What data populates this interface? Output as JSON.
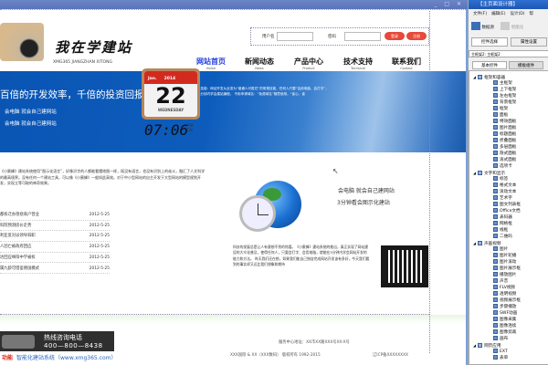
{
  "window": {
    "controls": "_ □ ✕"
  },
  "header": {
    "logo_title": "我在学建站",
    "logo_sub": "XMG365 JIANGZHAN XITONG",
    "login": {
      "user_label": "用户名",
      "pass_label": "密码",
      "login_btn": "登录",
      "register_btn": "注册"
    },
    "nav": [
      {
        "label": "网站首页",
        "en": "Home"
      },
      {
        "label": "新闻动态",
        "en": "News"
      },
      {
        "label": "产品中心",
        "en": "Product"
      },
      {
        "label": "技术支持",
        "en": "Technical"
      },
      {
        "label": "联系我们",
        "en": "Contact"
      }
    ]
  },
  "banner": {
    "headline": "百倍的开发效率，千倍的投资回报",
    "line1": "会电脑 就会自己建网站",
    "line2": "会电脑 就会自己建网站",
    "para": "不用专业技能：网站开发从此变为“普通人可胜任”的常规技能，任何人只要“会用电脑、会打字”，就能在几分钟内学会建站编程。 不用申请域名：“免费域名”随意使用，“省心、省"
  },
  "content": {
    "intro": "《小蜜蜂》建站系统使用“图示化语言”，好像识字的人都能看懂地图一样，既没有语言，也没有识别上的歧义，融汇了人文科学的最高境界。没有任何一个建站工具，可以像《小蜜蜂》一般如此高效。对于中小型网站的自主开发于大型网站的模型规划开发，实现立等可取的神奇效果。",
    "news": [
      {
        "title": "都拆迁办阻挠商户营业",
        "date": "2012-5-25"
      },
      {
        "title": "科院预测房价走势",
        "date": "2012-5-25"
      },
      {
        "title": "利亚反对派领导辞职",
        "date": "2012-5-25"
      },
      {
        "title": "人因亡被政府回应",
        "date": "2012-5-25"
      },
      {
        "title": "达回应绵阳中学被拆",
        "date": "2012-5-25"
      },
      {
        "title": "属九龄可借鉴德国模式",
        "date": "2012-5-25"
      }
    ],
    "calendar": {
      "month": "Jan.",
      "year": "2014",
      "day": "22",
      "weekday": "WEDNESDAY",
      "time": "07:06",
      "ampm": "PM",
      "seconds": "58"
    },
    "right_line1": "会电脑 就会自己建网站",
    "right_line2": "3分钟看会图示化建站",
    "para2": "科技的发展总是让人有意想不到的惊喜。《小蜜蜂》建站系统的推出，真正实现了网站建设的大众化普及，使得任何人，只要会打字、会用电脑，就能在3分钟内学会网站开发的能力和方法。 昨天我们还在想，如果我们能自己独自完成网站开发该有多好，今天我们看到的事实却又远比我们想象和期待"
  },
  "footer": {
    "hotline_title": "热线咨询电话",
    "hotline_number": "400—800—8438",
    "brand_logo": "功能",
    "brand": "智能化建站系统（www.xmg365.com）",
    "address": "服务中心地址：XX市XX路XXX号XX-X号",
    "copyright": "XXX国际 & XX（XXX数码）  版权所有  1992-2015",
    "icp": "辽ICP备XXXXXXXX"
  },
  "panel": {
    "title": "【主页面设计器】",
    "menu": [
      "文件(F)",
      "编辑(E)",
      "设计(D)",
      "帮"
    ],
    "tool1": "数据源",
    "tool2": "智能化",
    "btn_select": "控件选择",
    "btn_props": "属性设置",
    "path": "主框架2: 主框架2",
    "tab_basic": "基本控件",
    "tab_template": "模板组件",
    "tree": [
      {
        "group": "框架和容器",
        "items": [
          "主框架",
          "上下框架",
          "左右框架",
          "背景框架",
          "框架",
          "面板",
          "特效面板",
          "图片面板",
          "标题面板",
          "折叠面板",
          "多层面板",
          "隐式面板",
          "滚式面板",
          "选项卡"
        ]
      },
      {
        "group": "文字和显示",
        "items": [
          "标签",
          "格式文本",
          "滚动文本",
          "艺术字",
          "图文列表框",
          "Office文档",
          "表码器",
          "网格框",
          "线框",
          "二维码"
        ]
      },
      {
        "group": "声画视频",
        "items": [
          "图片",
          "图片轮播",
          "图片滚动",
          "图片展示框",
          "播放图片",
          "声音",
          "FLV视频",
          "透明视频",
          "视频展示框",
          "步骤播放",
          "SWF动画",
          "图像采集",
          "图像连续",
          "图像剪裁",
          "画布"
        ]
      },
      {
        "group": "网页应用",
        "items": [
          "EXT",
          "表单"
        ]
      }
    ]
  },
  "colors": {
    "accent_nav": "#2440e0",
    "banner": "#0d5cbc",
    "button_red": "#e54a3a"
  }
}
